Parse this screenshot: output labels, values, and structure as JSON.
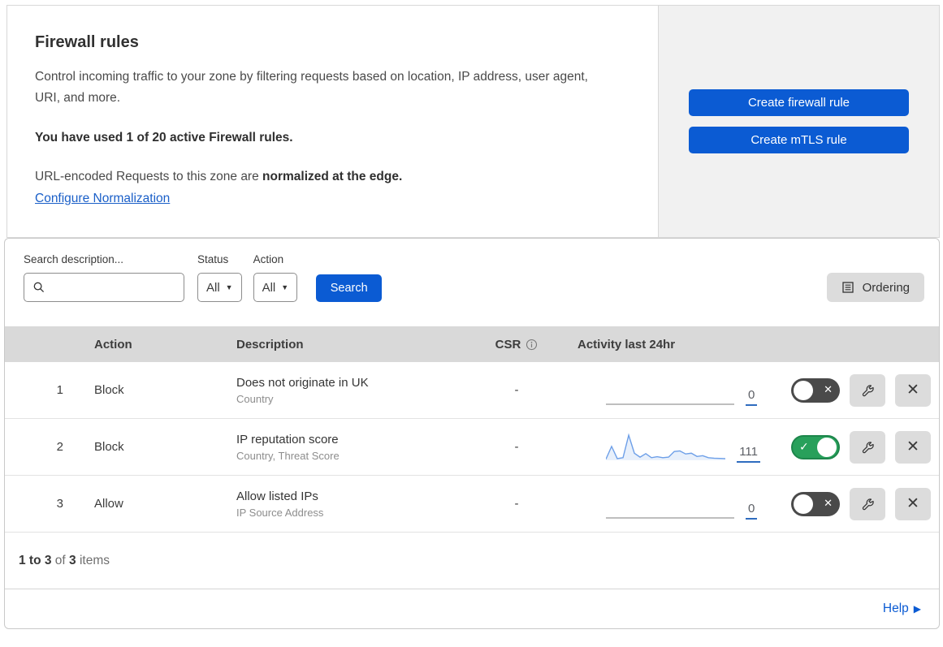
{
  "hero": {
    "title": "Firewall rules",
    "description": "Control incoming traffic to your zone by filtering requests based on location, IP address, user agent, URI, and more.",
    "usage_bold": "You have used 1 of 20 active Firewall rules.",
    "normalization_prefix": "URL-encoded Requests to this zone are ",
    "normalization_bold": "normalized at the edge.",
    "normalization_link": "Configure Normalization",
    "buttons": [
      {
        "label": "Create firewall rule"
      },
      {
        "label": "Create mTLS rule"
      }
    ]
  },
  "filters": {
    "search_label": "Search description...",
    "status_label": "Status",
    "status_value": "All",
    "action_label": "Action",
    "action_value": "All",
    "search_button": "Search",
    "ordering_button": "Ordering"
  },
  "table": {
    "headers": {
      "action": "Action",
      "description": "Description",
      "csr": "CSR",
      "activity": "Activity last 24hr"
    },
    "rows": [
      {
        "num": "1",
        "action": "Block",
        "description": "Does not originate in UK",
        "criteria": "Country",
        "csr": "-",
        "count": "0",
        "enabled": false,
        "spark": [
          0,
          0,
          0,
          0,
          0,
          0,
          0,
          0,
          0,
          0,
          0,
          0,
          0,
          0,
          0,
          0,
          0,
          0,
          0,
          0,
          0,
          0
        ]
      },
      {
        "num": "2",
        "action": "Block",
        "description": "IP reputation score",
        "criteria": "Country, Threat Score",
        "csr": "-",
        "count": "111",
        "enabled": true,
        "spark": [
          4,
          55,
          6,
          10,
          100,
          28,
          12,
          26,
          10,
          14,
          10,
          12,
          35,
          37,
          25,
          28,
          15,
          18,
          10,
          8,
          7,
          6
        ]
      },
      {
        "num": "3",
        "action": "Allow",
        "description": "Allow listed IPs",
        "criteria": "IP Source Address",
        "csr": "-",
        "count": "0",
        "enabled": false,
        "spark": [
          0,
          0,
          0,
          0,
          0,
          0,
          0,
          0,
          0,
          0,
          0,
          0,
          0,
          0,
          0,
          0,
          0,
          0,
          0,
          0,
          0,
          0
        ]
      }
    ],
    "footer": {
      "range": "1 to 3",
      "of": "of",
      "total": "3",
      "items": "items"
    }
  },
  "help_label": "Help",
  "colors": {
    "primary_blue": "#0b5bd3",
    "link_blue": "#1a5fc8",
    "toggle_green": "#28a05b",
    "toggle_gray": "#4a4a4a",
    "spark_blue": "#6d9fe8",
    "header_gray": "#d9d9d9"
  }
}
